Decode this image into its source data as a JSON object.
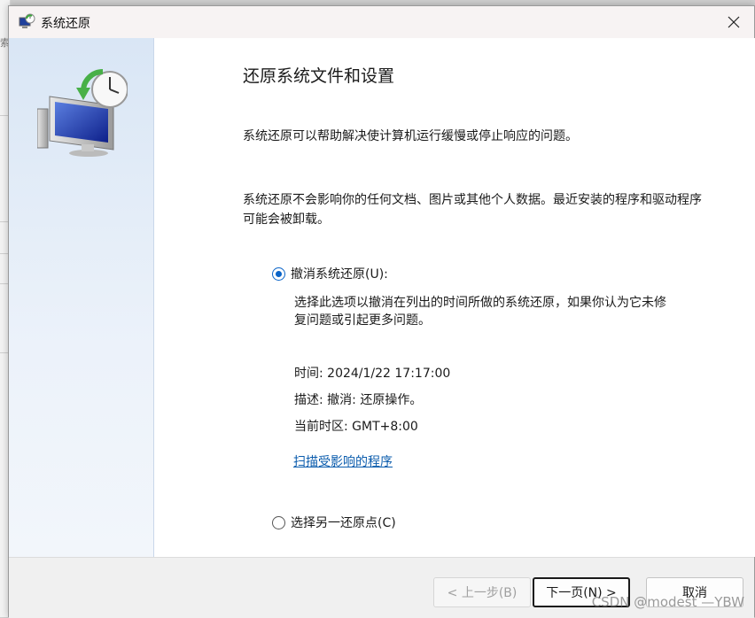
{
  "window": {
    "title": "系统还原",
    "close_icon": "close-icon"
  },
  "content": {
    "heading": "还原系统文件和设置",
    "para1": "系统还原可以帮助解决使计算机运行缓慢或停止响应的问题。",
    "para2": "系统还原不会影响你的任何文档、图片或其他个人数据。最近安装的程序和驱动程序可能会被卸载。"
  },
  "options": {
    "undo": {
      "label": "撤消系统还原(U):",
      "selected": true,
      "description": "选择此选项以撤消在列出的时间所做的系统还原，如果你认为它未修复问题或引起更多问题。",
      "time": "时间: 2024/1/22 17:17:00",
      "desc": "描述: 撤消: 还原操作。",
      "timezone": "当前时区: GMT+8:00",
      "scan_link": "扫描受影响的程序"
    },
    "other": {
      "label": "选择另一还原点(C)",
      "selected": false
    }
  },
  "footer": {
    "back_label": "< 上一步(B)",
    "next_label": "下一页(N) >",
    "cancel_label": "取消"
  },
  "watermark": "CSDN @modest —YBW",
  "colors": {
    "accent": "#0a64c8",
    "link": "#0b5cad",
    "sidebar_top": "#d9e6f5"
  }
}
